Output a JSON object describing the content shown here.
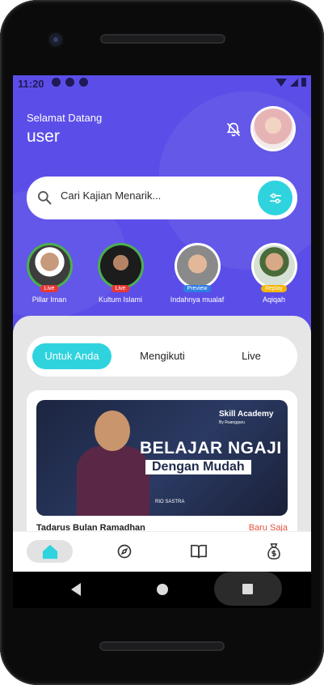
{
  "status_bar": {
    "time": "11:20"
  },
  "header": {
    "greeting": "Selamat Datang",
    "username": "user"
  },
  "search": {
    "placeholder": "Cari Kajian Menarik..."
  },
  "stories": [
    {
      "label": "Pillar Iman",
      "badge": "Live",
      "badge_color": "#e53935",
      "ring_color": "#4caf50"
    },
    {
      "label": "Kultum Islami",
      "badge": "Live",
      "badge_color": "#e53935",
      "ring_color": "#4caf50"
    },
    {
      "label": "Indahnya mualaf",
      "badge": "Preview",
      "badge_color": "#2f7de1",
      "ring_color": "#ffffff"
    },
    {
      "label": "Aqiqah",
      "badge": "Replay",
      "badge_color": "#f4b400",
      "ring_color": "#ffffff"
    }
  ],
  "tabs": [
    {
      "label": "Untuk Anda",
      "active": true
    },
    {
      "label": "Mengikuti",
      "active": false
    },
    {
      "label": "Live",
      "active": false
    }
  ],
  "card": {
    "brand": "Skill Academy",
    "brand_sub": "By Ruangguru",
    "headline": "BELAJAR NGAJI",
    "subheadline": "Dengan Mudah",
    "speaker": "RIO SASTRA",
    "title": "Tadarus Bulan Ramadhan",
    "tag": "Baru Saja"
  },
  "bottom_nav": [
    {
      "icon": "home-icon",
      "active": true
    },
    {
      "icon": "compass-icon",
      "active": false
    },
    {
      "icon": "book-icon",
      "active": false
    },
    {
      "icon": "money-bag-icon",
      "active": false
    }
  ],
  "colors": {
    "primary": "#5b4ee8",
    "accent": "#2fd3de",
    "tag": "#e5533d"
  }
}
